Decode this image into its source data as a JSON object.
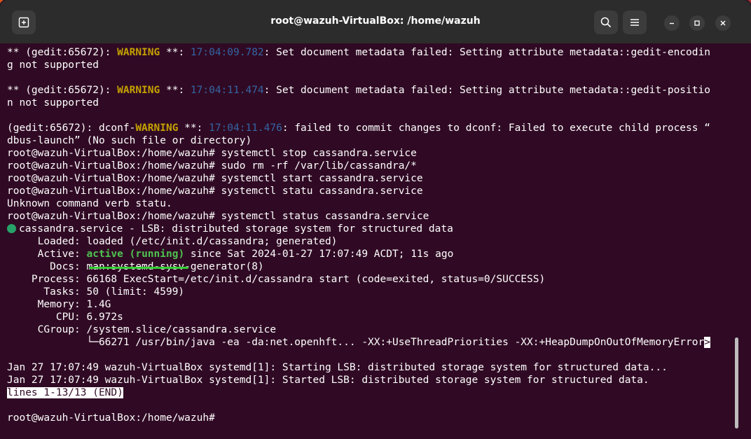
{
  "window": {
    "title": "root@wazuh-VirtualBox: /home/wazuh"
  },
  "titlebar": {
    "icons": [
      "new-tab-icon",
      "search-icon",
      "menu-icon",
      "minimize-icon",
      "maximize-icon",
      "close-icon"
    ]
  },
  "colors": {
    "background": "#300a24",
    "warning": "#c4a000",
    "timestamp": "#3465a4",
    "active": "#4fc24f",
    "status_dot": "#26a269"
  },
  "terminal": {
    "l1a": "** (gedit:65672): ",
    "l1b": "WARNING",
    "l1c": " **: ",
    "l1d": "17:04:09.782",
    "l1e": ": Set document metadata failed: Setting attribute metadata::gedit-encodin",
    "l2": "g not supported",
    "l4a": "** (gedit:65672): ",
    "l4b": "WARNING",
    "l4c": " **: ",
    "l4d": "17:04:11.474",
    "l4e": ": Set document metadata failed: Setting attribute metadata::gedit-positio",
    "l5": "n not supported",
    "l7a": "(gedit:65672): dconf-",
    "l7b": "WARNING",
    "l7c": " **: ",
    "l7d": "17:04:11.476",
    "l7e": ": failed to commit changes to dconf: Failed to execute child process “",
    "l8": "dbus-launch” (No such file or directory)",
    "l9": "root@wazuh-VirtualBox:/home/wazuh# systemctl stop cassandra.service",
    "l10": "root@wazuh-VirtualBox:/home/wazuh# sudo rm -rf /var/lib/cassandra/*",
    "l11": "root@wazuh-VirtualBox:/home/wazuh# systemctl start cassandra.service",
    "l12": "root@wazuh-VirtualBox:/home/wazuh# systemctl statu cassandra.service",
    "l13": "Unknown command verb statu.",
    "l14": "root@wazuh-VirtualBox:/home/wazuh# systemctl status cassandra.service",
    "l15": "cassandra.service - LSB: distributed storage system for structured data",
    "l16": "     Loaded: loaded (/etc/init.d/cassandra; generated)",
    "l17a": "     Active: ",
    "l17b": "active (running)",
    "l17c": " since Sat 2024-01-27 17:07:49 ACDT; 11s ago",
    "l18": "       Docs: man:systemd-sysv-generator(8)",
    "l19": "    Process: 66168 ExecStart=/etc/init.d/cassandra start (code=exited, status=0/SUCCESS)",
    "l20": "      Tasks: 50 (limit: 4599)",
    "l21": "     Memory: 1.4G",
    "l22": "        CPU: 6.972s",
    "l23": "     CGroup: /system.slice/cassandra.service",
    "l24a": "             └─66271 /usr/bin/java -ea -da:net.openhft... -XX:+UseThreadPriorities -XX:+HeapDumpOnOutOfMemoryError",
    "l24b": ">",
    "l26": "Jan 27 17:07:49 wazuh-VirtualBox systemd[1]: Starting LSB: distributed storage system for structured data...",
    "l27": "Jan 27 17:07:49 wazuh-VirtualBox systemd[1]: Started LSB: distributed storage system for structured data.",
    "l28": "lines 1-13/13 (END)",
    "l30": "root@wazuh-VirtualBox:/home/wazuh# "
  }
}
